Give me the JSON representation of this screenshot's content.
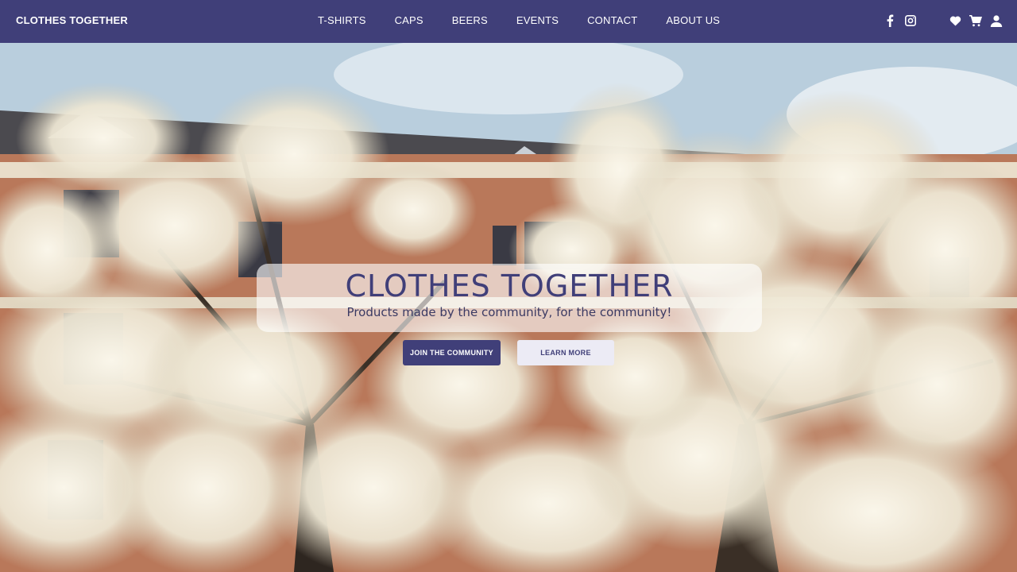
{
  "navbar": {
    "brand": "CLOTHES TOGETHER",
    "links": [
      "T-SHIRTS",
      "CAPS",
      "BEERS",
      "EVENTS",
      "CONTACT",
      "ABOUT US"
    ],
    "social_icons": [
      "facebook-icon",
      "instagram-icon"
    ],
    "action_icons": [
      "heart-icon",
      "cart-icon",
      "user-icon"
    ]
  },
  "hero": {
    "title": "CLOTHES TOGETHER",
    "subtitle": "Products made by the community, for the community!",
    "primary_button": "JOIN THE COMMUNITY",
    "secondary_button": "LEARN MORE"
  },
  "colors": {
    "brand": "#403f79",
    "button_light": "#ecebf5",
    "text_light": "#ffffff"
  }
}
